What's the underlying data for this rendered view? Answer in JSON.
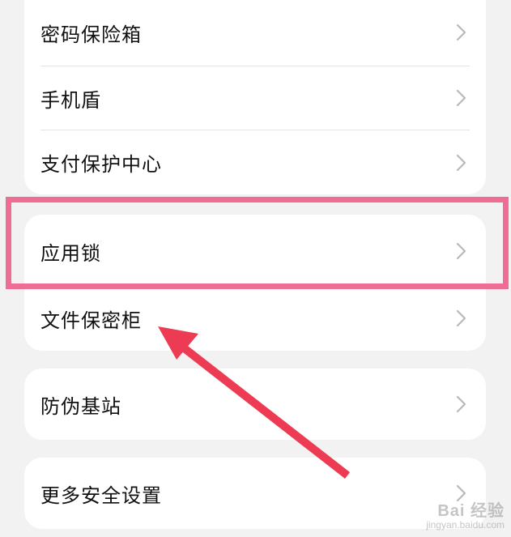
{
  "sections": [
    {
      "items": [
        {
          "label": "密码保险箱"
        },
        {
          "label": "手机盾"
        },
        {
          "label": "支付保护中心"
        }
      ]
    },
    {
      "items": [
        {
          "label": "应用锁",
          "highlighted": true
        },
        {
          "label": "文件保密柜"
        }
      ]
    },
    {
      "items": [
        {
          "label": "防伪基站"
        }
      ]
    },
    {
      "items": [
        {
          "label": "更多安全设置"
        }
      ]
    }
  ],
  "watermark": {
    "main": "Bai 经验",
    "sub": "jingyan.baidu.com"
  },
  "colors": {
    "background": "#f2f2f3",
    "card": "#ffffff",
    "highlight_border": "#ef6d94",
    "annotation_arrow": "#ec3b52"
  },
  "icons": {
    "row_chevron": "chevron-right-icon"
  }
}
